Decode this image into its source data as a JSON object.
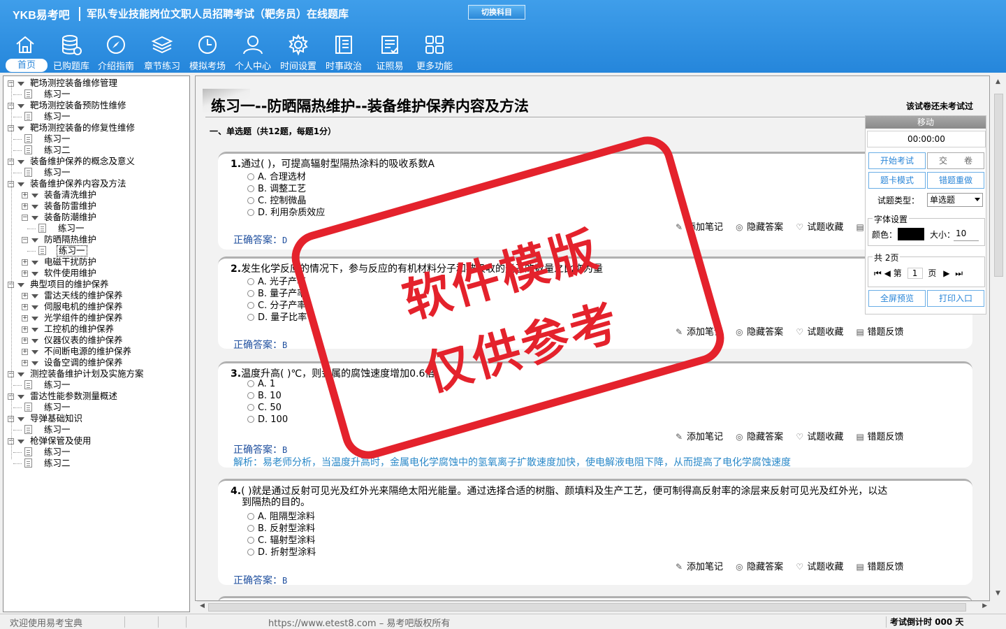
{
  "header": {
    "brand": "YKB易考吧",
    "title": "军队专业技能岗位文职人员招聘考试（靶务员）在线题库",
    "switch_button": "切换科目"
  },
  "nav": [
    {
      "label": "首页",
      "icon": "home-icon",
      "active": true
    },
    {
      "label": "已购题库",
      "icon": "database-icon"
    },
    {
      "label": "介绍指南",
      "icon": "compass-icon"
    },
    {
      "label": "章节练习",
      "icon": "layers-icon"
    },
    {
      "label": "模拟考场",
      "icon": "clock-icon"
    },
    {
      "label": "个人中心",
      "icon": "user-icon"
    },
    {
      "label": "时间设置",
      "icon": "gear-icon"
    },
    {
      "label": "时事政治",
      "icon": "book-icon"
    },
    {
      "label": "证照易",
      "icon": "certificate-icon"
    },
    {
      "label": "更多功能",
      "icon": "grid-icon"
    }
  ],
  "tree": [
    {
      "label": "靶场测控装备维修管理",
      "level": 0,
      "toggle": "minus"
    },
    {
      "label": "练习一",
      "level": 1,
      "leaf": true
    },
    {
      "label": "靶场测控装备预防性维修",
      "level": 0,
      "toggle": "minus"
    },
    {
      "label": "练习一",
      "level": 1,
      "leaf": true
    },
    {
      "label": "靶场测控装备的修复性维修",
      "level": 0,
      "toggle": "minus"
    },
    {
      "label": "练习一",
      "level": 1,
      "leaf": true
    },
    {
      "label": "练习二",
      "level": 1,
      "leaf": true
    },
    {
      "label": "装备维护保养的概念及意义",
      "level": 0,
      "toggle": "minus"
    },
    {
      "label": "练习一",
      "level": 1,
      "leaf": true
    },
    {
      "label": "装备维护保养内容及方法",
      "level": 0,
      "toggle": "minus"
    },
    {
      "label": "装备清洗维护",
      "level": 1,
      "toggle": "plus"
    },
    {
      "label": "装备防雷维护",
      "level": 1,
      "toggle": "plus"
    },
    {
      "label": "装备防潮维护",
      "level": 1,
      "toggle": "minus"
    },
    {
      "label": "练习一",
      "level": 2,
      "leaf": true
    },
    {
      "label": "防晒隔热维护",
      "level": 1,
      "toggle": "minus"
    },
    {
      "label": "练习一",
      "level": 2,
      "leaf": true,
      "selected": true
    },
    {
      "label": "电磁干扰防护",
      "level": 1,
      "toggle": "plus"
    },
    {
      "label": "软件使用维护",
      "level": 1,
      "toggle": "plus"
    },
    {
      "label": "典型项目的维护保养",
      "level": 0,
      "toggle": "minus"
    },
    {
      "label": "雷达天线的维护保养",
      "level": 1,
      "toggle": "plus"
    },
    {
      "label": "伺服电机的维护保养",
      "level": 1,
      "toggle": "plus"
    },
    {
      "label": "光学组件的维护保养",
      "level": 1,
      "toggle": "plus"
    },
    {
      "label": "工控机的维护保养",
      "level": 1,
      "toggle": "plus"
    },
    {
      "label": "仪器仪表的维护保养",
      "level": 1,
      "toggle": "plus"
    },
    {
      "label": "不间断电源的维护保养",
      "level": 1,
      "toggle": "plus"
    },
    {
      "label": "设备空调的维护保养",
      "level": 1,
      "toggle": "plus"
    },
    {
      "label": "测控装备维护计划及实施方案",
      "level": 0,
      "toggle": "minus"
    },
    {
      "label": "练习一",
      "level": 1,
      "leaf": true
    },
    {
      "label": "雷达性能参数测量概述",
      "level": 0,
      "toggle": "minus"
    },
    {
      "label": "练习一",
      "level": 1,
      "leaf": true
    },
    {
      "label": "导弹基础知识",
      "level": 0,
      "toggle": "minus"
    },
    {
      "label": "练习一",
      "level": 1,
      "leaf": true
    },
    {
      "label": "枪弹保管及使用",
      "level": 0,
      "toggle": "minus"
    },
    {
      "label": "练习一",
      "level": 1,
      "leaf": true
    },
    {
      "label": "练习二",
      "level": 1,
      "leaf": true
    }
  ],
  "main": {
    "heading": "练习一--防晒隔热维护--装备维护保养内容及方法",
    "exam_status": "该试卷还未考试过",
    "section_title": "一、单选题（共12题，每题1分）",
    "action_labels": [
      "添加笔记",
      "隐藏答案",
      "试题收藏",
      "错题反馈"
    ],
    "answer_prefix": "正确答案：",
    "questions": [
      {
        "num": "1.",
        "text": "通过(  )，可提高辐射型隔热涂料的吸收系数A",
        "options": [
          "A. 合理选材",
          "B. 调整工艺",
          "C. 控制微晶",
          "D. 利用杂质效应"
        ],
        "answer": "D"
      },
      {
        "num": "2.",
        "text": "发生化学反应的情况下，参与反应的有机材料分子和被吸收的光子的数量之比称为量",
        "options": [
          "A. 光子产率",
          "B. 量子产率",
          "C. 分子产率",
          "D. 量子比率"
        ],
        "answer": "B"
      },
      {
        "num": "3.",
        "text": "温度升高(  )℃，则金属的腐蚀速度增加0.6倍",
        "options": [
          "A. 1",
          "B. 10",
          "C. 50",
          "D. 100"
        ],
        "answer": "B",
        "analysis": "解析：易老师分析，当温度升高时，金属电化学腐蚀中的氢氧离子扩散速度加快，使电解液电阻下降，从而提高了电化学腐蚀速度"
      },
      {
        "num": "4.",
        "text": "(  )就是通过反射可见光及红外光来隔绝太阳光能量。通过选择合适的树脂、颜填料及生产工艺，便可制得高反射率的涂层来反射可见光及红外光，以达",
        "text2": "到隔热的目的。",
        "options": [
          "A. 阻隔型涂料",
          "B. 反射型涂料",
          "C. 辐射型涂料",
          "D. 折射型涂料"
        ],
        "answer": "B"
      }
    ]
  },
  "panel": {
    "move_label": "移动",
    "timer": "00:00:00",
    "start_exam": "开始考试",
    "submit": "交　　卷",
    "card_mode": "题卡模式",
    "redo_wrong": "错题重做",
    "type_label": "试题类型：",
    "type_value": "单选题",
    "font_legend": "字体设置",
    "color_label": "颜色：",
    "size_label": "大小：",
    "size_value": "10",
    "pages_legend": "共 2页",
    "page_prefix": "第",
    "page_value": "1",
    "page_suffix": "页",
    "fullscreen": "全屏预览",
    "print": "打印入口",
    "font_color": "#000000"
  },
  "watermark": {
    "line1": "软件模版",
    "line2": "仅供参考",
    "color": "#e4222c"
  },
  "status": {
    "welcome": "欢迎使用易考宝典",
    "copyright": "https://www.etest8.com – 易考吧版权所有",
    "countdown": "考试倒计时 000 天"
  }
}
